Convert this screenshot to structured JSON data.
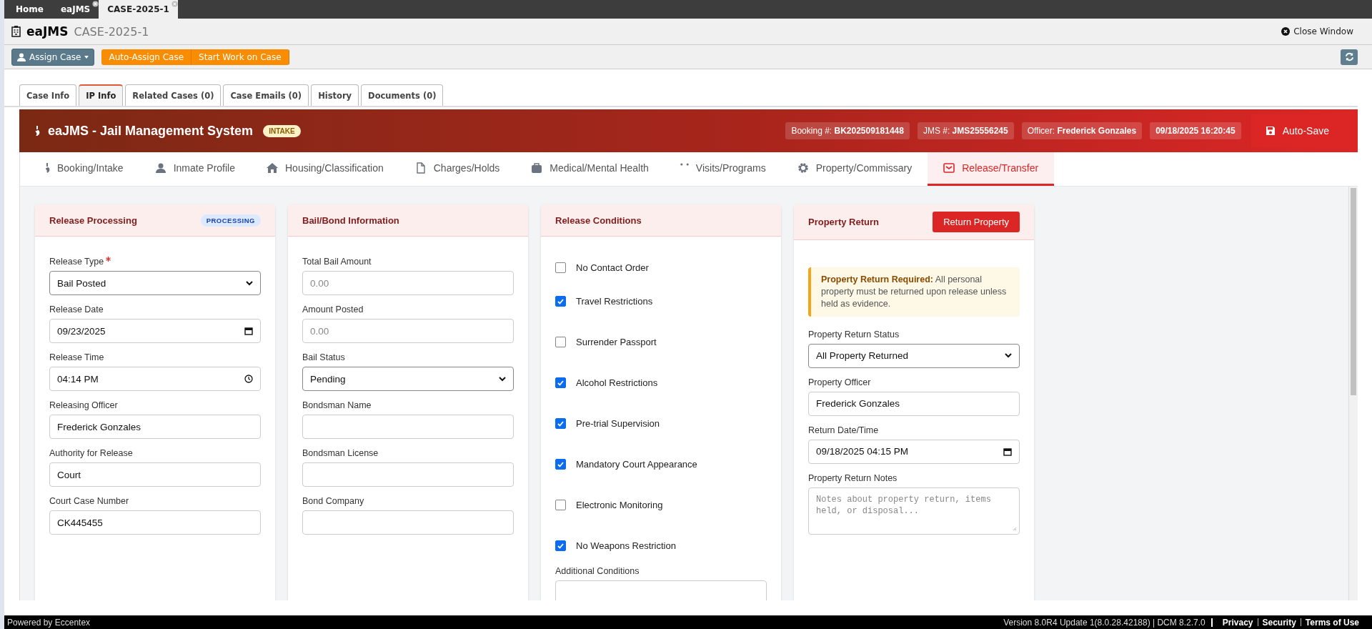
{
  "app_tabs": [
    {
      "label": "Home",
      "closable": false,
      "selected": false
    },
    {
      "label": "eaJMS",
      "closable": true,
      "selected": false
    },
    {
      "label": "CASE-2025-1",
      "closable": true,
      "selected": true
    }
  ],
  "title": {
    "app": "eaJMS",
    "case": "CASE-2025-1"
  },
  "close_window": "Close Window",
  "toolbar": {
    "assign": "Assign Case",
    "actions": [
      "Auto-Assign Case",
      "Start Work on Case"
    ]
  },
  "case_tabs": [
    {
      "label": "Case Info",
      "selected": false
    },
    {
      "label": "IP Info",
      "selected": true
    },
    {
      "label": "Related Cases (0)",
      "selected": false
    },
    {
      "label": "Case Emails (0)",
      "selected": false
    },
    {
      "label": "History",
      "selected": false
    },
    {
      "label": "Documents (0)",
      "selected": false
    }
  ],
  "header": {
    "title": "eaJMS - Jail Management System",
    "badge": "INTAKE",
    "chips": [
      {
        "label": "Booking #:",
        "value": "BK202509181448"
      },
      {
        "label": "JMS #:",
        "value": "JMS25556245"
      },
      {
        "label": "Officer:",
        "value": "Frederick Gonzales"
      },
      {
        "value": "09/18/2025 16:20:45"
      }
    ],
    "auto_save": "Auto-Save"
  },
  "modules": [
    {
      "label": "Booking/Intake",
      "selected": false
    },
    {
      "label": "Inmate Profile",
      "selected": false
    },
    {
      "label": "Housing/Classification",
      "selected": false
    },
    {
      "label": "Charges/Holds",
      "selected": false
    },
    {
      "label": "Medical/Mental Health",
      "selected": false
    },
    {
      "label": "Visits/Programs",
      "selected": false
    },
    {
      "label": "Property/Commissary",
      "selected": false
    },
    {
      "label": "Release/Transfer",
      "selected": true
    }
  ],
  "cards": [
    {
      "title": "Release Processing",
      "badge": "PROCESSING",
      "fields": [
        {
          "kind": "select",
          "label": "Release Type",
          "required": true,
          "value": "Bail Posted"
        },
        {
          "kind": "date",
          "label": "Release Date",
          "required": false,
          "value": "09/23/2025"
        },
        {
          "kind": "time",
          "label": "Release Time",
          "required": false,
          "value": "04:14 PM"
        },
        {
          "kind": "text",
          "label": "Releasing Officer",
          "required": false,
          "value": "Frederick Gonzales"
        },
        {
          "kind": "text",
          "label": "Authority for Release",
          "required": false,
          "value": "Court"
        },
        {
          "kind": "text",
          "label": "Court Case Number",
          "required": false,
          "value": "CK445455"
        }
      ]
    },
    {
      "title": "Bail/Bond Information",
      "fields": [
        {
          "kind": "text",
          "label": "Total Bail Amount",
          "required": false,
          "placeholder": "0.00"
        },
        {
          "kind": "text",
          "label": "Amount Posted",
          "required": false,
          "placeholder": "0.00"
        },
        {
          "kind": "select",
          "label": "Bail Status",
          "required": false,
          "value": "Pending"
        },
        {
          "kind": "text",
          "label": "Bondsman Name",
          "required": false
        },
        {
          "kind": "text",
          "label": "Bondsman License",
          "required": false
        },
        {
          "kind": "text",
          "label": "Bond Company",
          "required": false
        }
      ]
    },
    {
      "title": "Release Conditions",
      "checks": [
        {
          "label": "No Contact Order",
          "checked": false
        },
        {
          "label": "Travel Restrictions",
          "checked": true
        },
        {
          "label": "Surrender Passport",
          "checked": false
        },
        {
          "label": "Alcohol Restrictions",
          "checked": true
        },
        {
          "label": "Pre-trial Supervision",
          "checked": true
        },
        {
          "label": "Mandatory Court Appearance",
          "checked": true
        },
        {
          "label": "Electronic Monitoring",
          "checked": false
        },
        {
          "label": "No Weapons Restriction",
          "checked": true
        }
      ],
      "fields": [
        {
          "kind": "textarea",
          "label": "Additional Conditions",
          "required": false
        }
      ]
    },
    {
      "title": "Property Return",
      "button": "Return Property",
      "alert": {
        "strong": "Property Return Required:",
        "text": "All personal property must be returned upon release unless held as evidence."
      },
      "fields": [
        {
          "kind": "select",
          "label": "Property Return Status",
          "required": false,
          "value": "All Property Returned"
        },
        {
          "kind": "text",
          "label": "Property Officer",
          "required": false,
          "value": "Frederick Gonzales"
        },
        {
          "kind": "datetime",
          "label": "Return Date/Time",
          "required": false,
          "value": "09/18/2025 04:15 PM"
        },
        {
          "kind": "textarea",
          "label": "Property Return Notes",
          "required": false,
          "placeholder": "Notes about property return, items held, or disposal..."
        }
      ]
    }
  ],
  "footer": {
    "powered": "Powered by Eccentex",
    "version": "Version  8.0R4 Update 1(8.0.28.42188) | DCM 8.2.7.0",
    "links": [
      "Privacy",
      "Security",
      "Terms of Use"
    ]
  }
}
